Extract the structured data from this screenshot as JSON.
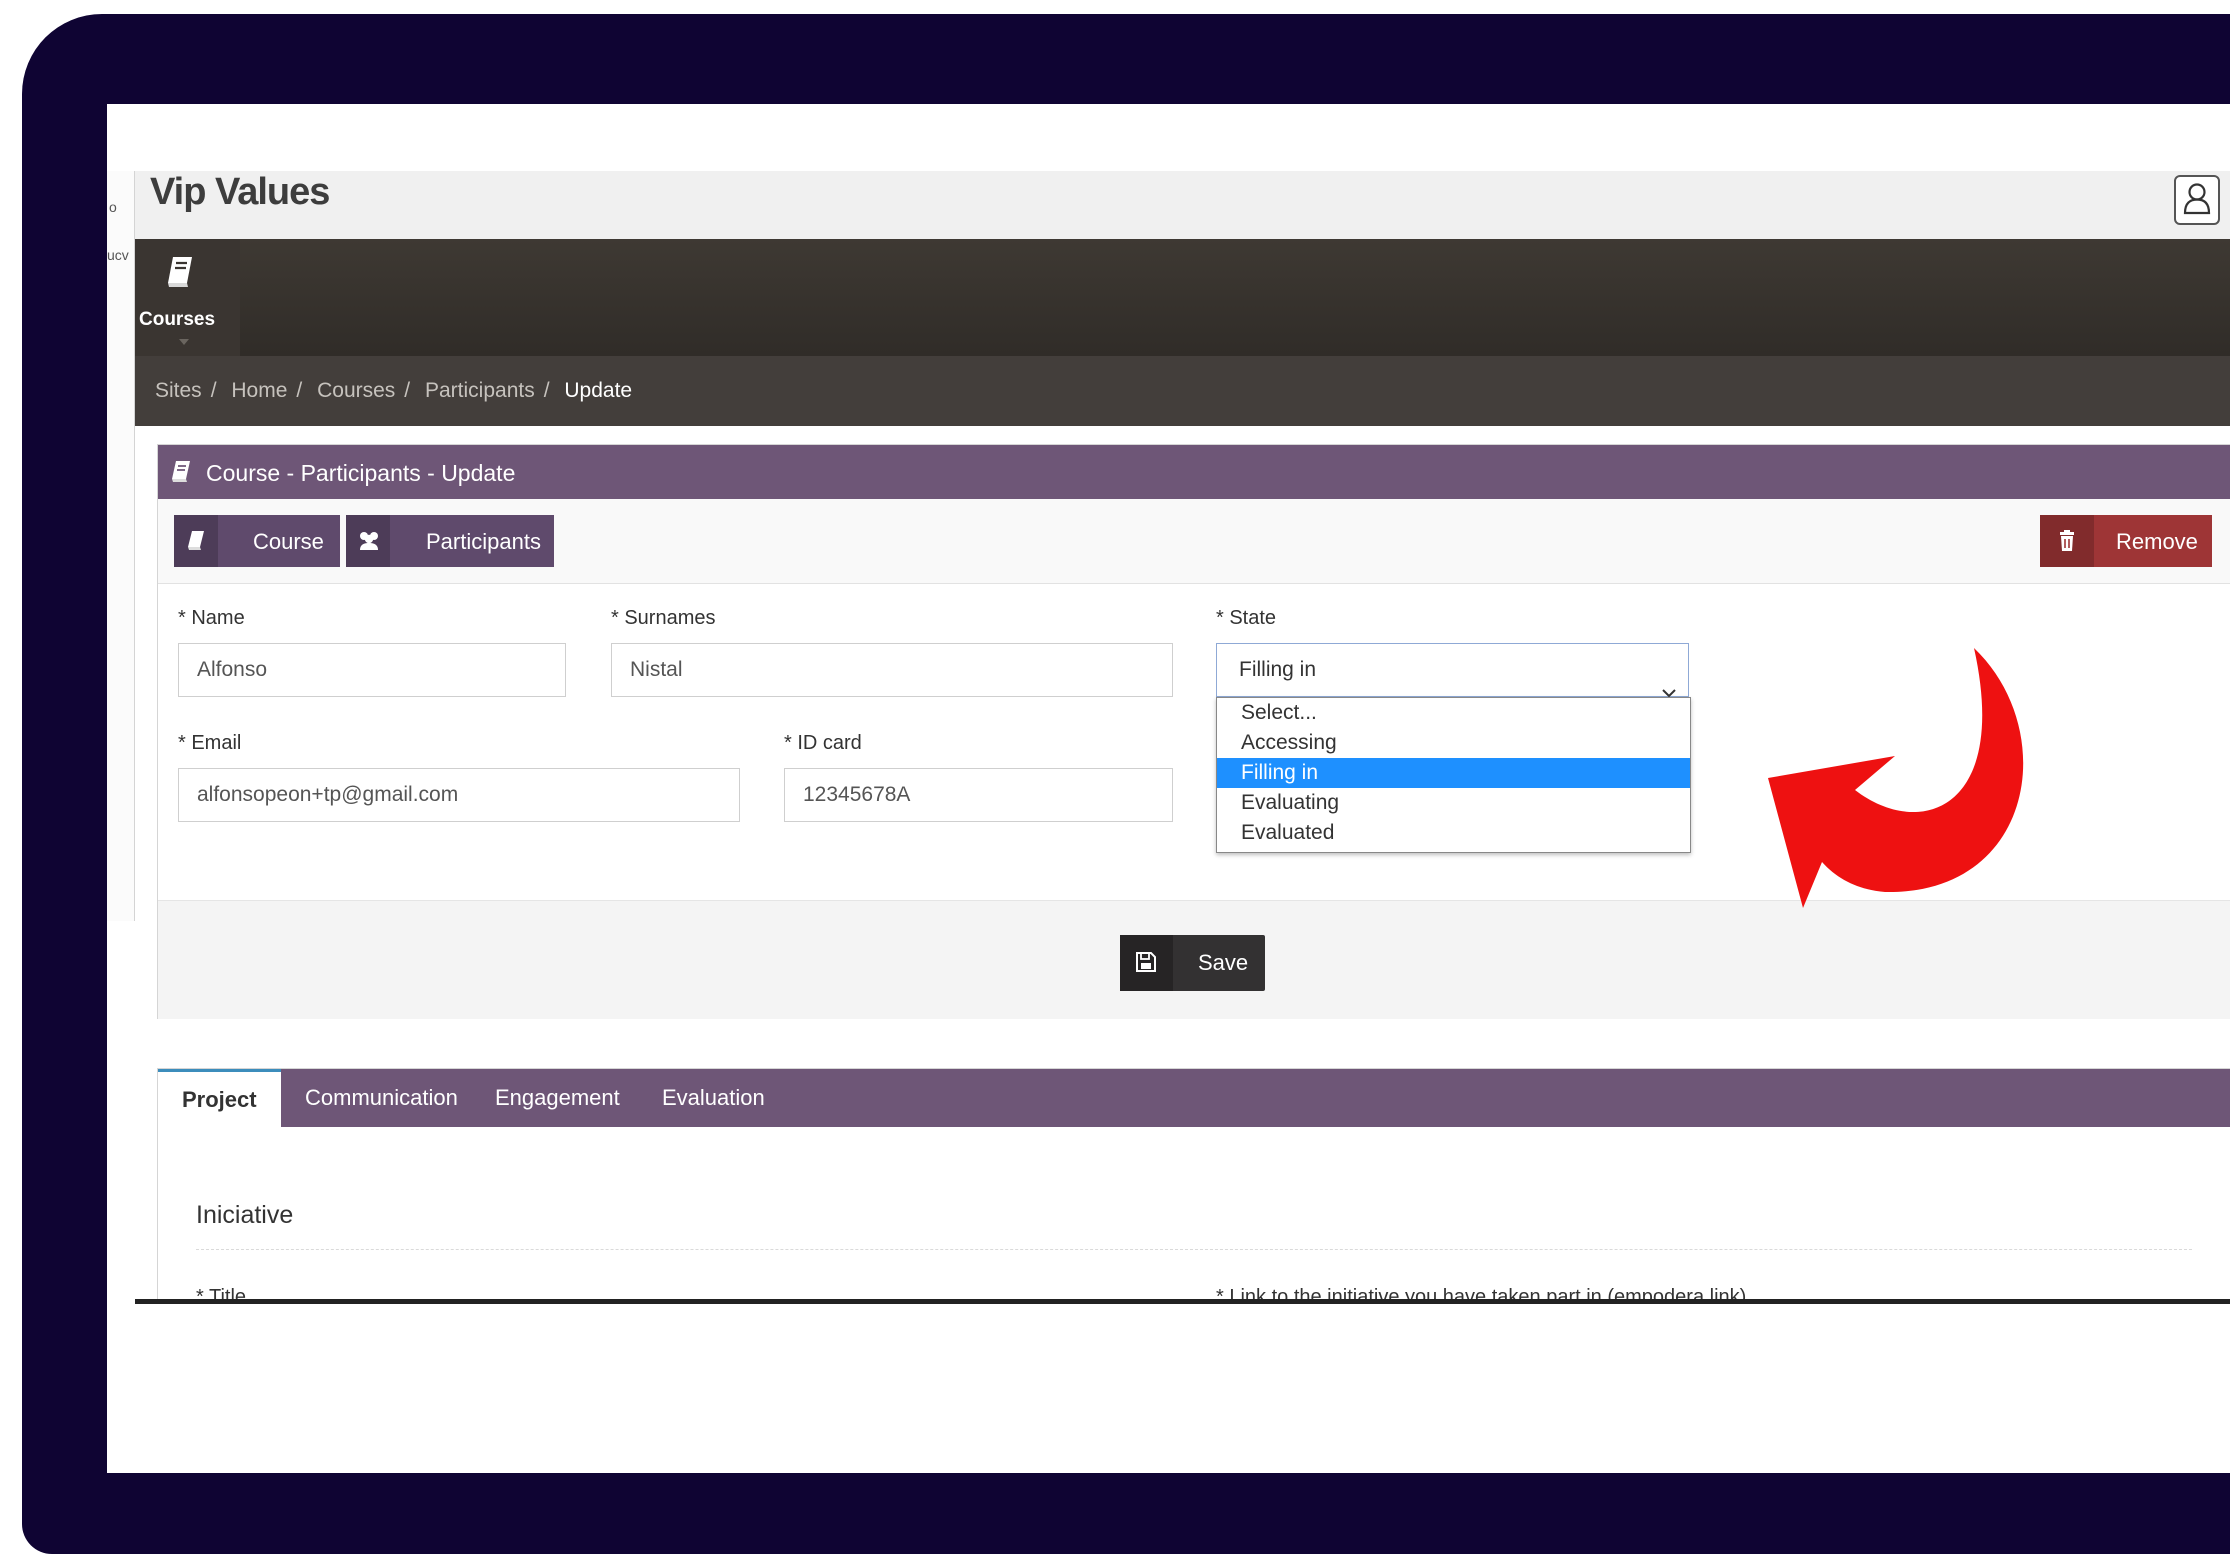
{
  "strip": {
    "top_glyph": "o",
    "side_text": "ucv"
  },
  "app": {
    "title": "Vip Values"
  },
  "nav": {
    "courses_label": "Courses"
  },
  "breadcrumb": {
    "items": [
      "Sites",
      "Home",
      "Courses",
      "Participants"
    ],
    "separator": "/",
    "current": "Update"
  },
  "panel": {
    "title": "Course - Participants - Update",
    "course_button": "Course",
    "participants_button": "Participants",
    "remove_button": "Remove"
  },
  "form": {
    "name_label": "* Name",
    "name_value": "Alfonso",
    "surnames_label": "* Surnames",
    "surnames_value": "Nistal",
    "state_label": "* State",
    "state_value": "Filling in",
    "email_label": "* Email",
    "email_value": "alfonsopeon+tp@gmail.com",
    "idcard_label": "* ID card",
    "idcard_value": "12345678A"
  },
  "state_options": [
    "Select...",
    "Accessing",
    "Filling in",
    "Evaluating",
    "Evaluated"
  ],
  "state_selected": "Filling in",
  "save_button": "Save",
  "tabs": [
    "Project",
    "Communication",
    "Engagement",
    "Evaluation"
  ],
  "active_tab": "Project",
  "section": {
    "title": "Iniciative",
    "title_field_label": "* Title",
    "link_field_label": "* Link to the initiative you have taken part in (empodera link)"
  },
  "colors": {
    "frame": "#0f0433",
    "purple": "#6e5677",
    "danger": "#9e3536",
    "nav_dark": "#3a3531",
    "selected_option": "#1e90ff",
    "arrow": "#ee1111"
  },
  "icons": {
    "user": "user-icon",
    "book": "book-icon",
    "users": "users-icon",
    "trash": "trash-icon",
    "save": "save-icon",
    "chevron": "chevron-down-icon",
    "arrow": "curved-arrow-icon"
  }
}
